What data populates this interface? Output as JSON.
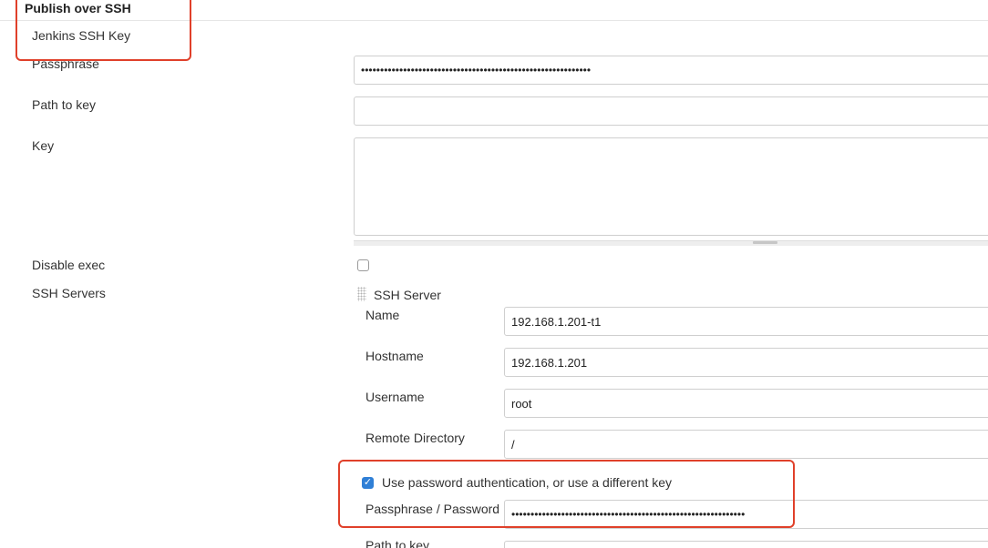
{
  "section": {
    "title": "Publish over SSH"
  },
  "global": {
    "jenkins_ssh_key_label": "Jenkins SSH Key",
    "passphrase_label": "Passphrase",
    "passphrase_value": "••••••••••••••••••••••••••••••••••••••••••••••••••••••••••••",
    "path_to_key_label": "Path to key",
    "path_to_key_value": "",
    "key_label": "Key",
    "key_value": "",
    "disable_exec_label": "Disable exec",
    "disable_exec_checked": false,
    "ssh_servers_label": "SSH Servers"
  },
  "server": {
    "heading": "SSH Server",
    "name_label": "Name",
    "name_value": "192.168.1.201-t1",
    "hostname_label": "Hostname",
    "hostname_value": "192.168.1.201",
    "username_label": "Username",
    "username_value": "root",
    "remote_dir_label": "Remote Directory",
    "remote_dir_value": "/",
    "use_password_label": "Use password authentication, or use a different key",
    "use_password_checked": true,
    "passphrase_password_label": "Passphrase / Password",
    "passphrase_password_value": "•••••••••••••••••••••••••••••••••••••••••••••••••••••••••••••",
    "path_to_key_label": "Path to key"
  },
  "colors": {
    "highlight": "#e0402a",
    "checkbox_checked": "#2f7fd6"
  }
}
